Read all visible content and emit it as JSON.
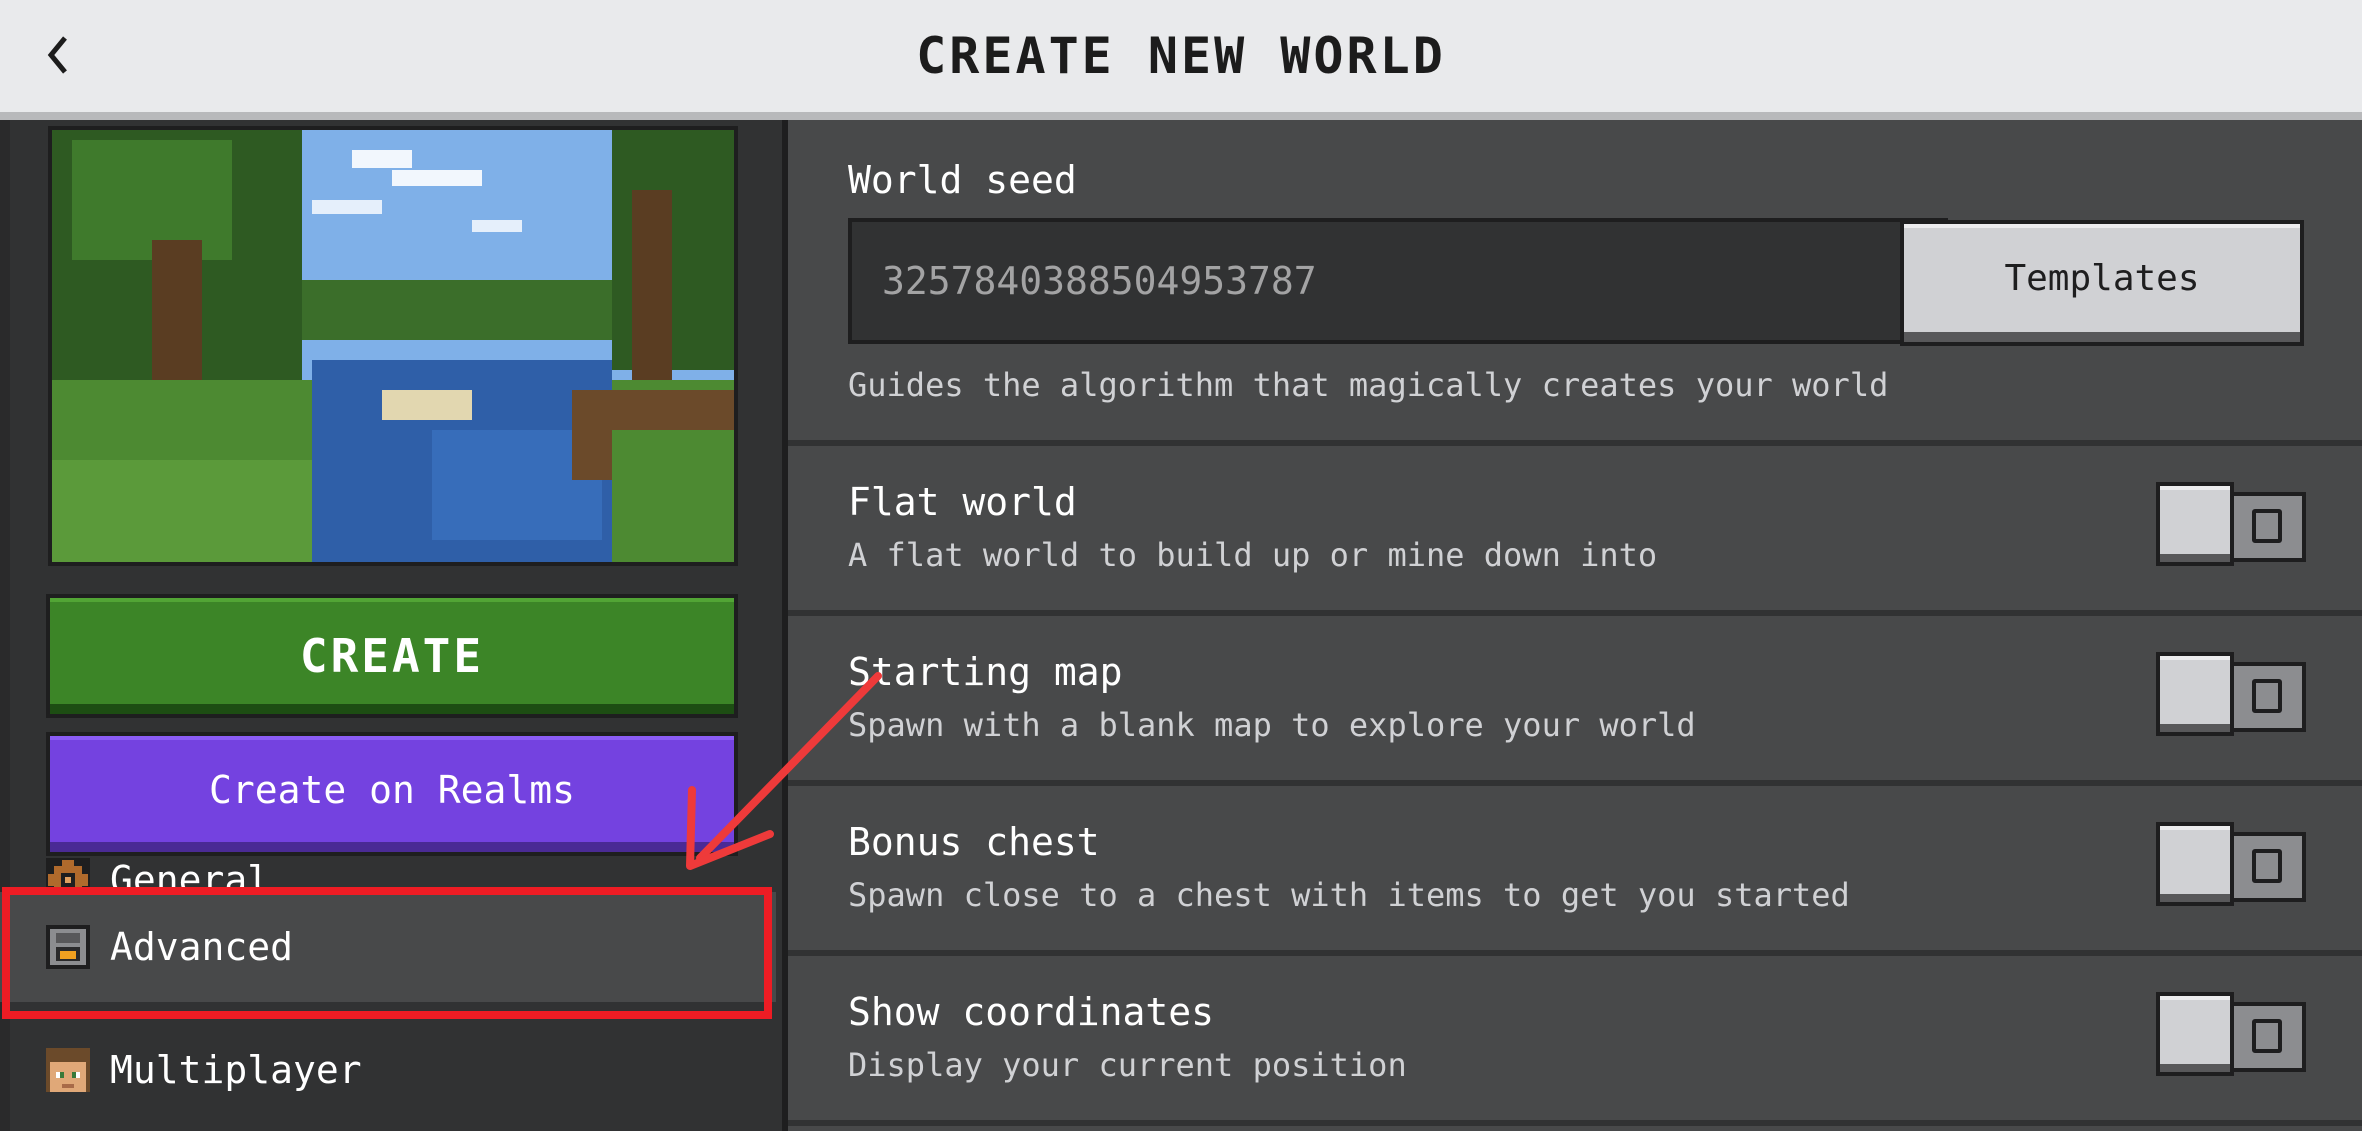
{
  "header": {
    "title": "Create New World",
    "back_icon": "chevron-left-icon"
  },
  "sidebar": {
    "create_label": "CREATE",
    "realms_label": "Create on Realms",
    "items": [
      {
        "label": "General",
        "icon": "gear-icon"
      },
      {
        "label": "Advanced",
        "icon": "furnace-icon",
        "selected": true
      },
      {
        "label": "Multiplayer",
        "icon": "player-head-icon"
      }
    ]
  },
  "main": {
    "seed": {
      "label": "World seed",
      "value": "3257840388504953787",
      "templates_label": "Templates",
      "description": "Guides the algorithm that magically creates your world"
    },
    "options": [
      {
        "title": "Flat world",
        "description": "A flat world to build up or mine down into",
        "enabled": false
      },
      {
        "title": "Starting map",
        "description": "Spawn with a blank map to explore your world",
        "enabled": false
      },
      {
        "title": "Bonus chest",
        "description": "Spawn close to a chest with items to get you started",
        "enabled": false
      },
      {
        "title": "Show coordinates",
        "description": "Display your current position",
        "enabled": false
      }
    ]
  },
  "annotation": {
    "highlight_color": "#ee1c24",
    "target": "Advanced"
  },
  "colors": {
    "create_green": "#3c8527",
    "realms_purple": "#7442e0",
    "panel_dark": "#313233",
    "panel_mid": "#48494a"
  }
}
